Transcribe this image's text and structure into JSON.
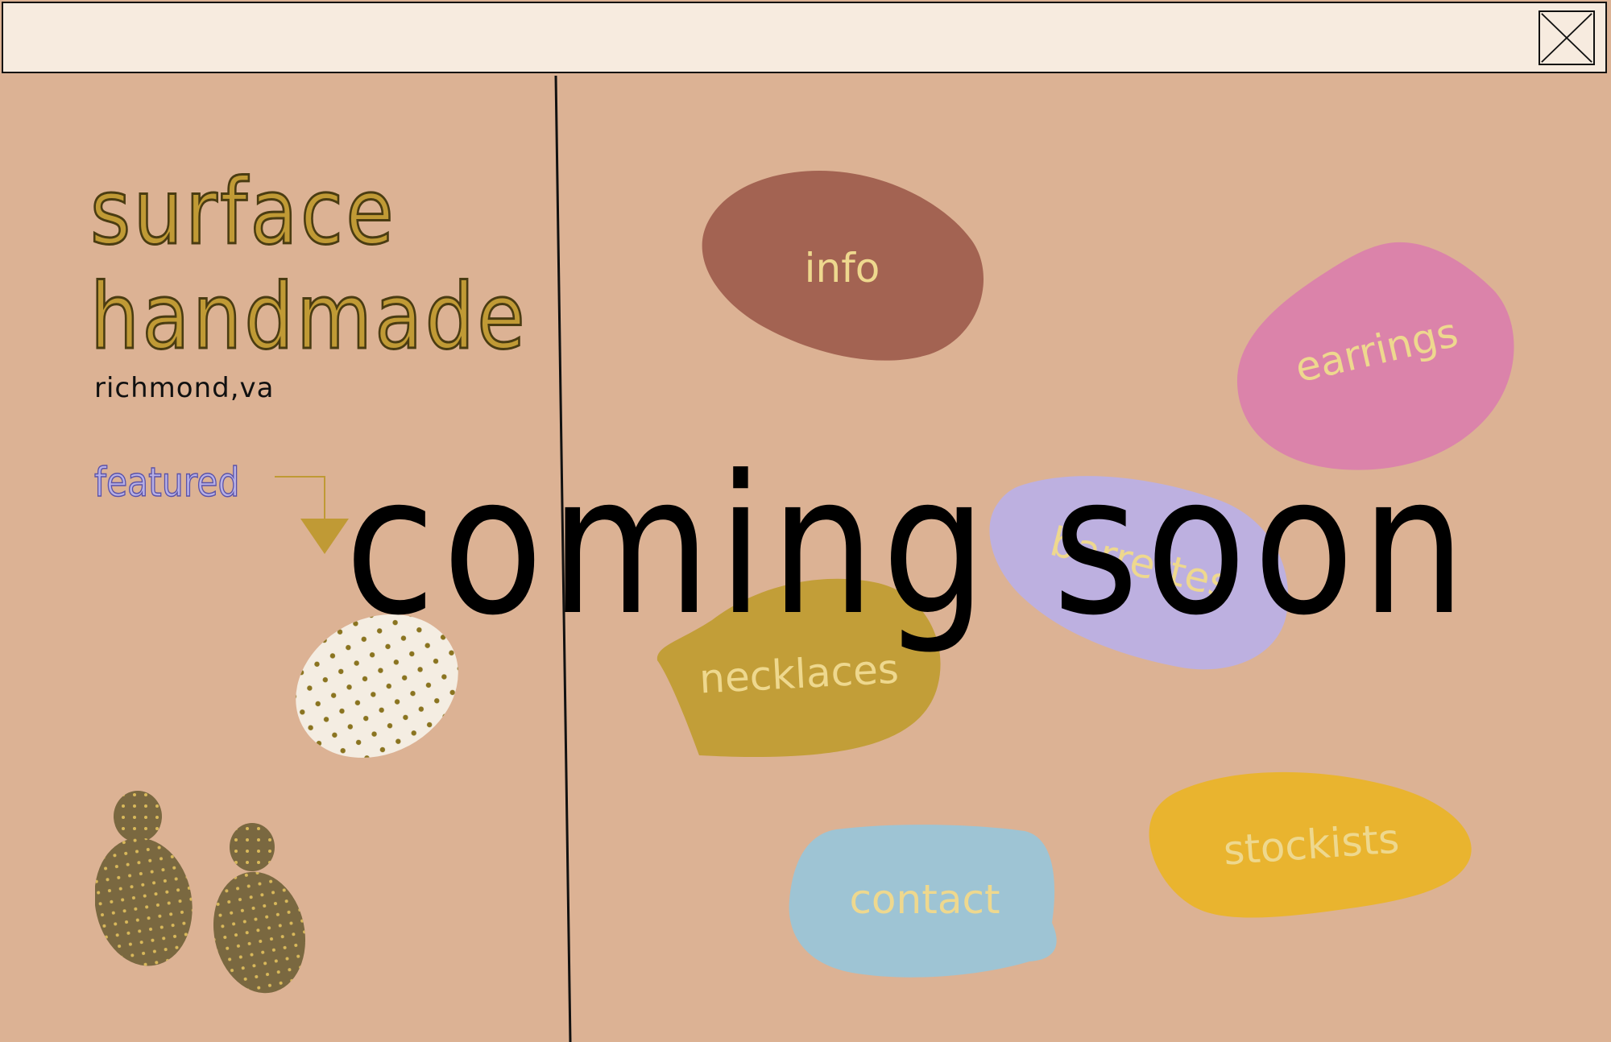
{
  "brand": {
    "line1": "surface",
    "line2": "handmade",
    "location": "richmond,va",
    "featured_label": "featured"
  },
  "nav": {
    "info": "info",
    "earrings": "earrings",
    "barrettes": "barrettes",
    "necklaces": "necklaces",
    "contact": "contact",
    "stockists": "stockists"
  },
  "overlay": {
    "text": "coming soon"
  },
  "colors": {
    "background": "#dcb294",
    "titlebar": "#f7ebdf",
    "brand_gold": "#c09a35",
    "info_blob": "#a36352",
    "earrings_blob": "#db83aa",
    "barrettes_blob": "#bdb0e0",
    "necklaces_blob": "#c29e38",
    "contact_blob": "#9ec4d4",
    "stockists_blob": "#e9b42f",
    "label_text": "#eed88e",
    "featured_text": "#b7b0e6"
  },
  "icons": {
    "close": "close-x-icon",
    "arrow": "arrow-down-right-icon"
  }
}
